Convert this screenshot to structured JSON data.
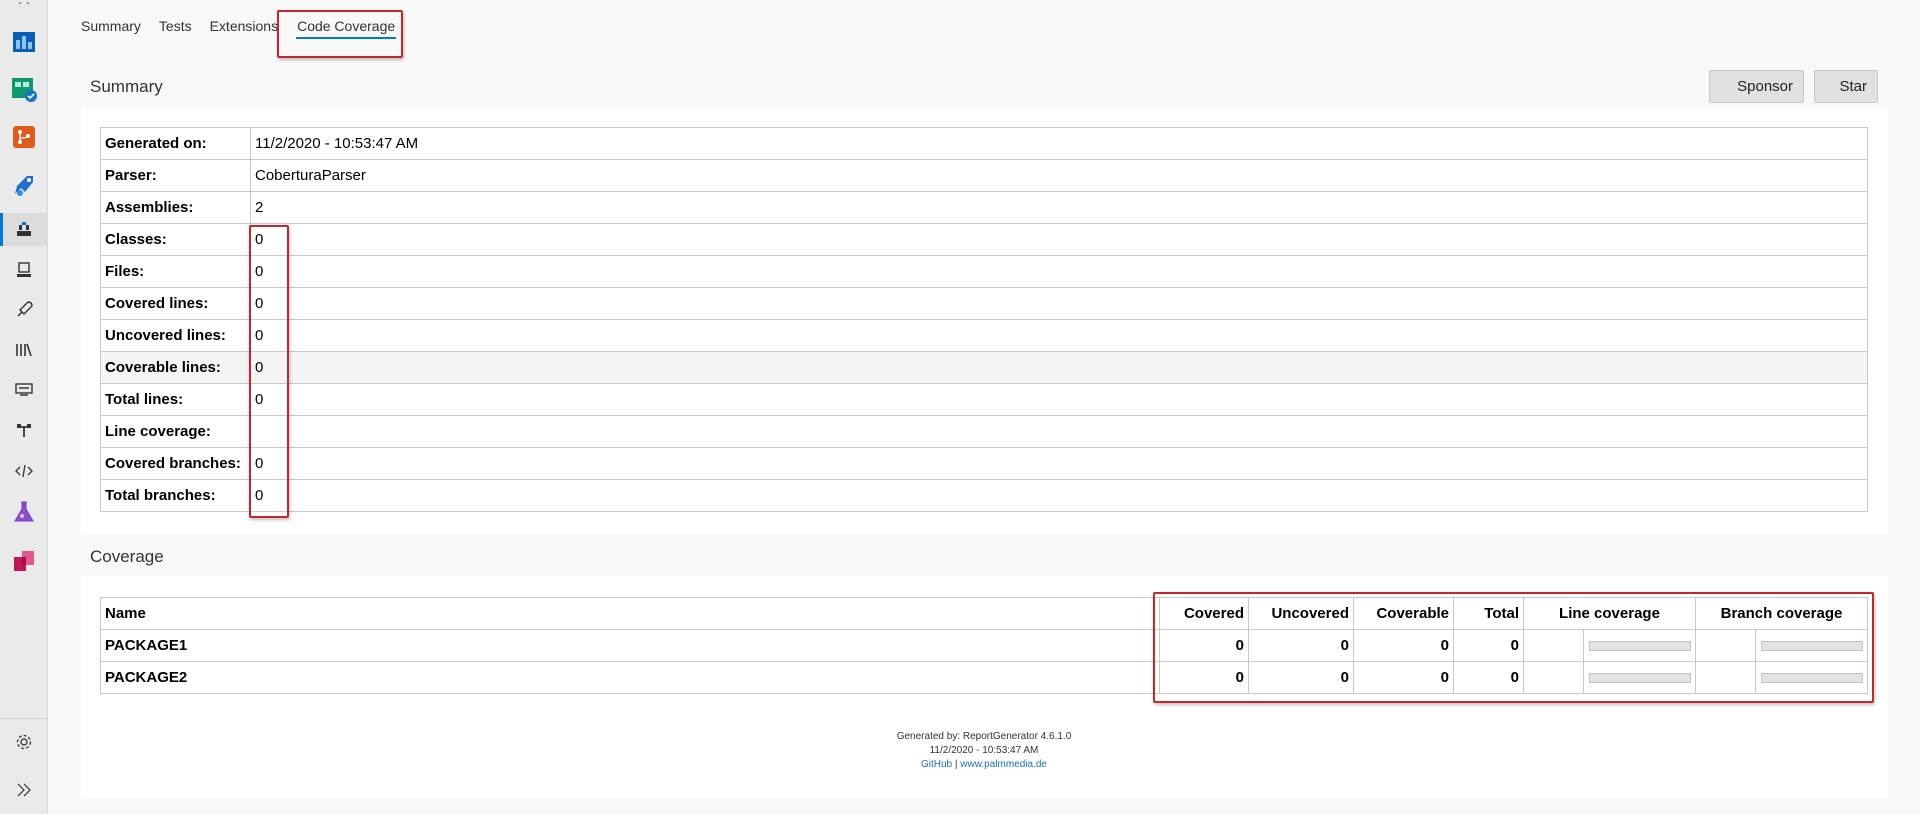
{
  "tabs": [
    {
      "label": "Summary"
    },
    {
      "label": "Tests"
    },
    {
      "label": "Extensions"
    },
    {
      "label": "Code Coverage"
    }
  ],
  "summary": {
    "title": "Summary",
    "sponsor_label": "Sponsor",
    "star_label": "Star",
    "rows": [
      {
        "key": "Generated on:",
        "value": "11/2/2020 - 10:53:47 AM"
      },
      {
        "key": "Parser:",
        "value": "CoberturaParser"
      },
      {
        "key": "Assemblies:",
        "value": "2"
      },
      {
        "key": "Classes:",
        "value": "0"
      },
      {
        "key": "Files:",
        "value": "0"
      },
      {
        "key": "Covered lines:",
        "value": "0"
      },
      {
        "key": "Uncovered lines:",
        "value": "0"
      },
      {
        "key": "Coverable lines:",
        "value": "0"
      },
      {
        "key": "Total lines:",
        "value": "0"
      },
      {
        "key": "Line coverage:",
        "value": ""
      },
      {
        "key": "Covered branches:",
        "value": "0"
      },
      {
        "key": "Total branches:",
        "value": "0"
      }
    ]
  },
  "coverage": {
    "title": "Coverage",
    "headers": {
      "name": "Name",
      "covered": "Covered",
      "uncovered": "Uncovered",
      "coverable": "Coverable",
      "total": "Total",
      "line_coverage": "Line coverage",
      "branch_coverage": "Branch coverage"
    },
    "rows": [
      {
        "name": "PACKAGE1",
        "covered": "0",
        "uncovered": "0",
        "coverable": "0",
        "total": "0"
      },
      {
        "name": "PACKAGE2",
        "covered": "0",
        "uncovered": "0",
        "coverable": "0",
        "total": "0"
      }
    ]
  },
  "footer": {
    "generated_by": "Generated by: ReportGenerator 4.6.1.0",
    "timestamp": "11/2/2020 - 10:53:47 AM",
    "link_github": "GitHub",
    "separator": "|",
    "link_site": "www.palmmedia.de"
  },
  "colors": {
    "accent": "#0078d4",
    "highlight_box": "#c0282d"
  }
}
